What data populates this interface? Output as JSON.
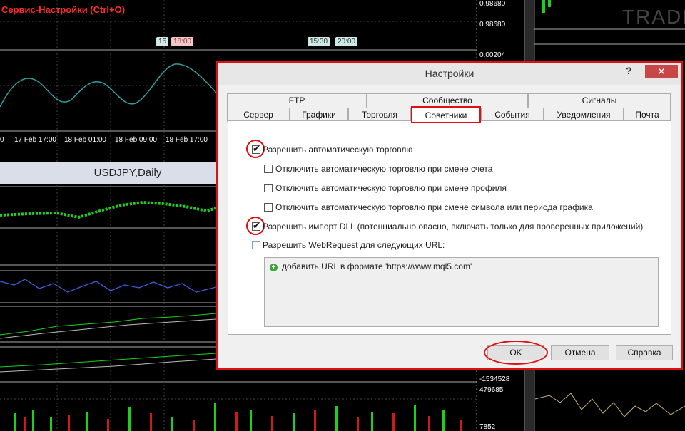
{
  "caption": "Сервис-Настройки (Ctrl+O)",
  "chart": {
    "prices": [
      "0.98680",
      "0.00204",
      "-1534528",
      "479685",
      "7852"
    ],
    "top_partial_price": "0.98680",
    "time_labels": [
      "17 Feb 17:00",
      "18 Feb 01:00",
      "18 Feb 09:00",
      "18 Feb 17:00"
    ],
    "left_partial_time": "0",
    "tags": {
      "t1": "15",
      "t2": "18:00",
      "t3": "15:30",
      "t4": "20:00"
    },
    "symbol_title": "USDJPY,Daily",
    "watermark": "TRADI",
    "colors": {
      "green": "#19d219",
      "blue": "#3a5ed8",
      "red": "#d21919",
      "white": "#ffffff"
    }
  },
  "dialog": {
    "title": "Настройки",
    "help": "?",
    "close": "✕",
    "tabs_row1": [
      "FTP",
      "Сообщество",
      "Сигналы"
    ],
    "tabs_row2": [
      "Сервер",
      "Графики",
      "Торговля",
      "Советники",
      "События",
      "Уведомления",
      "Почта"
    ],
    "active_tab": "Советники",
    "options": [
      {
        "label": "Разрешить автоматическую торговлю",
        "checked": true
      },
      {
        "label": "Отключить автоматическую торговлю при смене счета",
        "checked": false
      },
      {
        "label": "Отключить автоматическую торговлю при смене профиля",
        "checked": false
      },
      {
        "label": "Отключить автоматическую торговлю при смене символа или периода графика",
        "checked": false
      },
      {
        "label": "Разрешить импорт DLL (потенциально опасно, включать только для проверенных приложений)",
        "checked": true
      },
      {
        "label": "Разрешить WebRequest для следующих URL:",
        "checked": false
      }
    ],
    "url_add": "добавить URL в формате 'https://www.mql5.com'",
    "buttons": {
      "ok": "OK",
      "cancel": "Отмена",
      "help": "Справка"
    },
    "accent": "#e01010"
  }
}
